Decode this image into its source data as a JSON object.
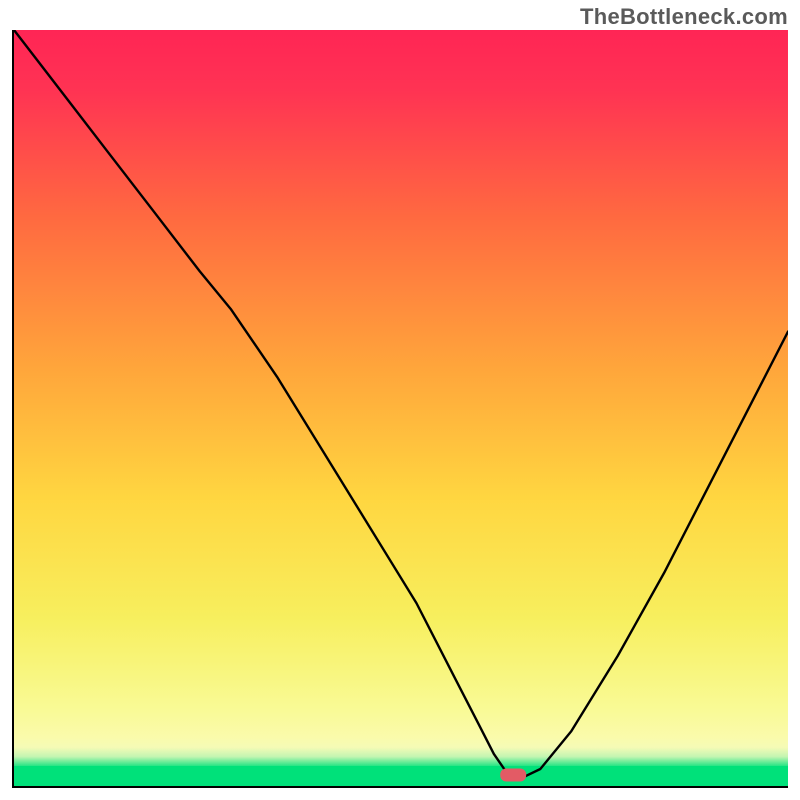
{
  "watermark": "TheBottleneck.com",
  "chart_data": {
    "type": "line",
    "title": "",
    "xlabel": "",
    "ylabel": "",
    "xlim": [
      0,
      100
    ],
    "ylim": [
      0,
      100
    ],
    "grid": false,
    "legend": false,
    "background_gradient": {
      "top": "#ff2555",
      "mid_upper": "#ff7a3c",
      "mid": "#ffd640",
      "lower": "#f7f98a",
      "green_band": "#00e17a"
    },
    "marker": {
      "x": 64.5,
      "y": 1.2,
      "color": "#e35b65",
      "shape": "pill"
    },
    "series": [
      {
        "name": "curve",
        "x": [
          0,
          6,
          12,
          18,
          24,
          28,
          34,
          40,
          46,
          52,
          57,
          60,
          62,
          64,
          66,
          68,
          72,
          78,
          84,
          90,
          96,
          100
        ],
        "y": [
          100,
          92,
          84,
          76,
          68,
          63,
          54,
          44,
          34,
          24,
          14,
          8,
          4,
          1,
          1,
          2,
          7,
          17,
          28,
          40,
          52,
          60
        ]
      }
    ]
  }
}
